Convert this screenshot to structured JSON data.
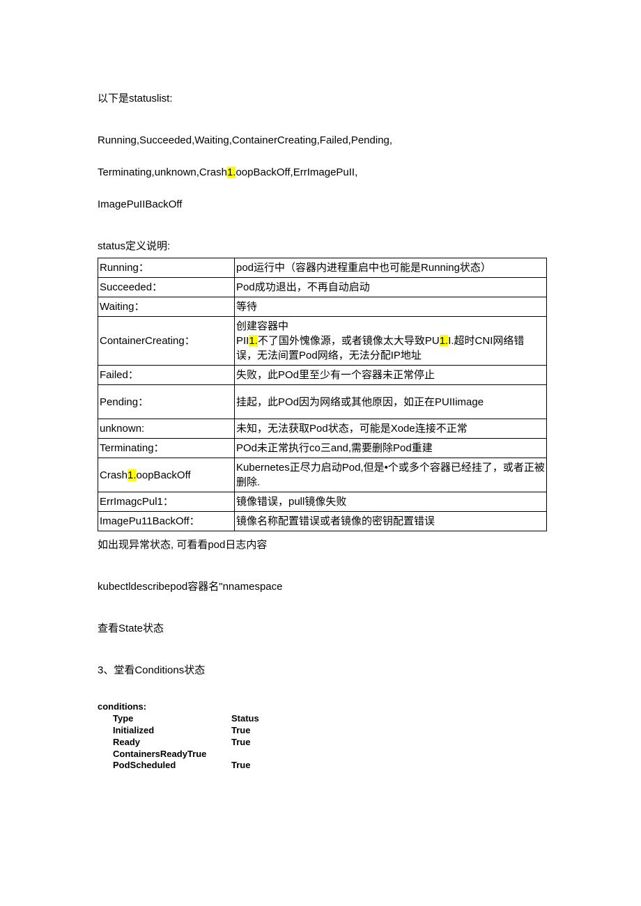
{
  "intro": {
    "line1": "以下是statuslist:",
    "line2": "Running,Succeeded,Waiting,ContainerCreating,Failed,Pending,",
    "line3_a": "Terminating,unknown,Crash",
    "line3_hl": "1.",
    "line3_b": "oopBackOff,ErrImagePuII,",
    "line4": "ImagePuIIBackOff",
    "defs_title": "status定义说明:"
  },
  "table": [
    {
      "k": "Running：",
      "v_parts": [
        {
          "t": "pod运行中（容器内进程重启中也可能是Running状态）"
        }
      ]
    },
    {
      "k": "Succeeded：",
      "v_parts": [
        {
          "t": "Pod成功退出，不再自动启动"
        }
      ]
    },
    {
      "k": "Waiting：",
      "v_parts": [
        {
          "t": "等待"
        }
      ]
    },
    {
      "k": "ContainerCreating：",
      "v_parts": [
        {
          "t": "创建容器中",
          "br": true
        },
        {
          "t": "PII"
        },
        {
          "t": "1.",
          "hl": true
        },
        {
          "t": "不了国外愧像源，或者镜像太大导致PU"
        },
        {
          "t": "1.",
          "hl": true
        },
        {
          "t": "I.超时CNI网络错误，无法间置Pod网络，无法分配IP地址"
        }
      ]
    },
    {
      "k": "Failed：",
      "v_parts": [
        {
          "t": "失败，此POd里至少有一个容器未正常停止"
        }
      ]
    },
    {
      "k": "Pending：",
      "v_parts": [
        {
          "t": "挂起，此POd因为网络或其他原因，如正在PUIIimage"
        }
      ],
      "tall": true
    },
    {
      "k": "unknown:",
      "v_parts": [
        {
          "t": "未知，无法获取Pod状态，可能是Xode连接不正常"
        }
      ]
    },
    {
      "k": "Terminating：",
      "v_parts": [
        {
          "t": "POd未正常执行co三and,需要删除Pod重建"
        }
      ]
    },
    {
      "k_parts": [
        {
          "t": "Crash"
        },
        {
          "t": "1.",
          "hl": true
        },
        {
          "t": "oopBackOff"
        }
      ],
      "v_parts": [
        {
          "t": "Kubernetes正尽力启动Pod,但是•个或多个容器已经挂了，或者正被删除."
        }
      ]
    },
    {
      "k": "ErrImagcPul1：",
      "v_parts": [
        {
          "t": "镜像错误，pull镜像失败"
        }
      ]
    },
    {
      "k": "ImagePu11BackOff：",
      "v_parts": [
        {
          "t": "镜像名称配置错误或者镜像的密钥配置错误"
        }
      ]
    }
  ],
  "after": {
    "l1": "如出现异常状态, 可看看pod日志内容",
    "l2": "kubectldescribepod容器名\"nnamespace",
    "l3": "查看State状态",
    "l4": "3、堂看Conditions状态"
  },
  "conditions": {
    "title": "conditions:",
    "header_type": "Type",
    "header_status": "Status",
    "rows": [
      {
        "type": "Initialized",
        "status": "True"
      },
      {
        "type": "Ready",
        "status": "True"
      },
      {
        "type": "ContainersReadyTrue",
        "status": ""
      },
      {
        "type": "PodScheduled",
        "status": "True"
      }
    ]
  }
}
